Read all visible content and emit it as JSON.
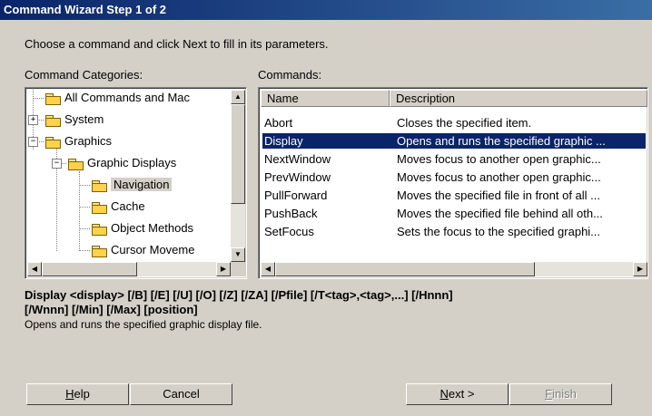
{
  "window": {
    "title": "Command Wizard Step 1 of 2"
  },
  "instructions": "Choose a command and click Next to fill in its parameters.",
  "categories": {
    "label": "Command Categories:",
    "items": [
      {
        "label": "All Commands and Mac"
      },
      {
        "label": "System",
        "expander": "+"
      },
      {
        "label": "Graphics",
        "expander": "−"
      },
      {
        "label": "Graphic Displays",
        "expander": "−"
      },
      {
        "label": "Navigation",
        "selected": true
      },
      {
        "label": "Cache"
      },
      {
        "label": "Object Methods"
      },
      {
        "label": "Cursor Moveme"
      }
    ]
  },
  "commands": {
    "label": "Commands:",
    "columns": [
      "Name",
      "Description"
    ],
    "rows": [
      {
        "name": "Abort",
        "description": "Closes the specified item."
      },
      {
        "name": "Display",
        "description": "Opens and runs the specified graphic ...",
        "selected": true
      },
      {
        "name": "NextWindow",
        "description": "Moves focus to another open graphic..."
      },
      {
        "name": "PrevWindow",
        "description": "Moves focus to another open graphic..."
      },
      {
        "name": "PullForward",
        "description": "Moves the specified file in front of all ..."
      },
      {
        "name": "PushBack",
        "description": "Moves the specified file behind all oth..."
      },
      {
        "name": "SetFocus",
        "description": "Sets the focus to the specified graphi..."
      }
    ]
  },
  "syntax": {
    "line1": "Display <display> [/B] [/E] [/U] [/O] [/Z] [/ZA] [/Pfile] [/T<tag>,<tag>,...] [/Hnnn]",
    "line2": "[/Wnnn] [/Min] [/Max] [position]",
    "description": "Opens and runs the specified graphic display file."
  },
  "buttons": {
    "help": {
      "label": "Help",
      "mnemonic": "H",
      "rest": "elp"
    },
    "cancel": {
      "label": "Cancel"
    },
    "next": {
      "label": "Next >",
      "mnemonic": "N",
      "rest": "ext >"
    },
    "finish": {
      "label": "Finish",
      "mnemonic": "F",
      "rest": "inish"
    }
  },
  "icons": [
    "folder-icon",
    "expand-icon",
    "collapse-icon",
    "scroll-up-icon",
    "scroll-down-icon",
    "scroll-left-icon",
    "scroll-right-icon"
  ]
}
